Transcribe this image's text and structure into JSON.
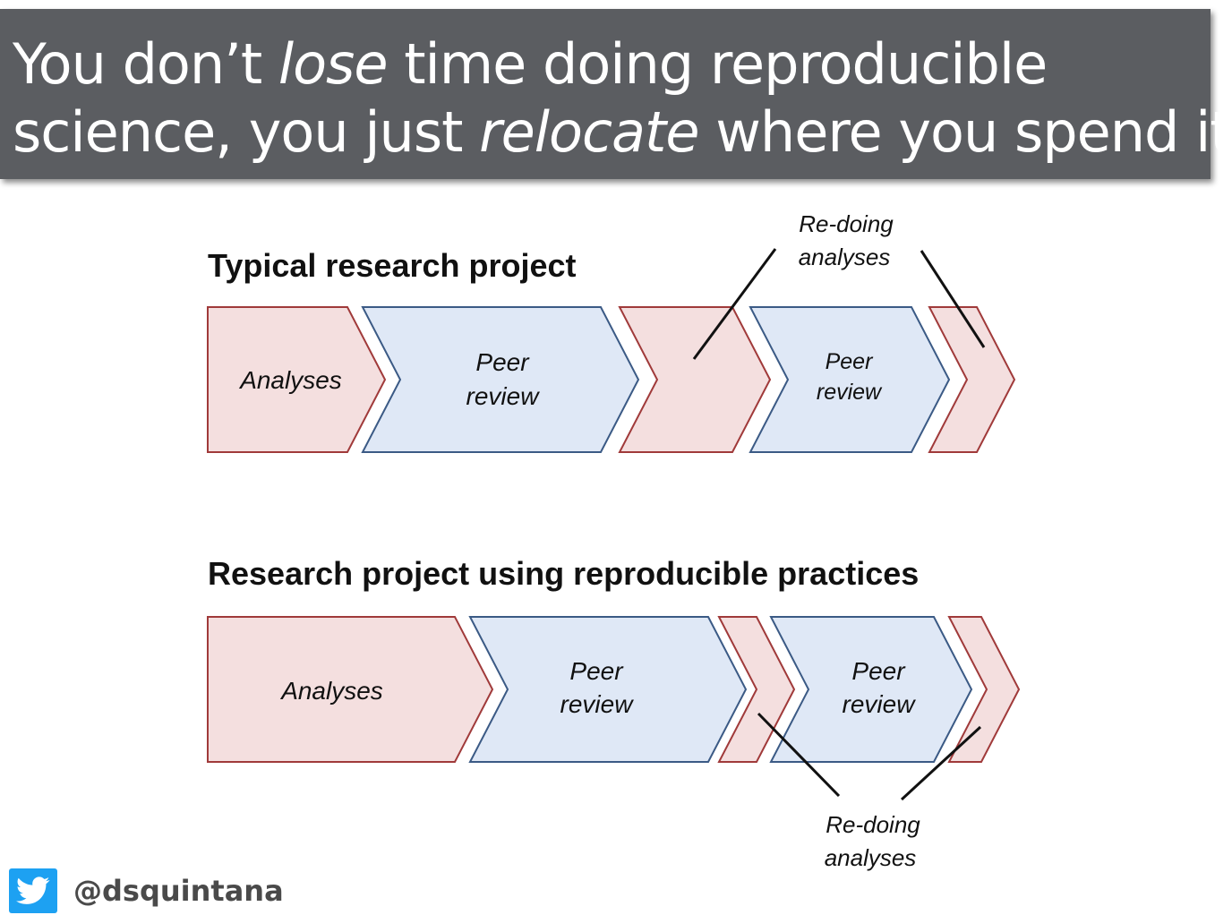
{
  "title": {
    "line1_a": "You don’t ",
    "line1_em": "lose",
    "line1_b": " time doing reproducible",
    "line2_a": "science, you just ",
    "line2_em": "relocate",
    "line2_b": " where you spend it"
  },
  "sections": {
    "typical": {
      "title": "Typical research project",
      "steps": {
        "analyses": "Analyses",
        "peer_review_1": {
          "line1": "Peer",
          "line2": "review"
        },
        "peer_review_2": {
          "line1": "Peer",
          "line2": "review"
        }
      },
      "annotation": {
        "line1": "Re-doing",
        "line2": "analyses"
      }
    },
    "reproducible": {
      "title": "Research project using reproducible practices",
      "steps": {
        "analyses": "Analyses",
        "peer_review_1": {
          "line1": "Peer",
          "line2": "review"
        },
        "peer_review_2": {
          "line1": "Peer",
          "line2": "review"
        }
      },
      "annotation": {
        "line1": "Re-doing",
        "line2": "analyses"
      }
    }
  },
  "colors": {
    "analysis_fill": "#f4dfdf",
    "analysis_stroke": "#a03a3a",
    "review_fill": "#dfe8f6",
    "review_stroke": "#3b5a85",
    "title_bar": "#5b5d61"
  },
  "footer": {
    "handle": "@dsquintana",
    "icon": "twitter-bird-icon"
  }
}
